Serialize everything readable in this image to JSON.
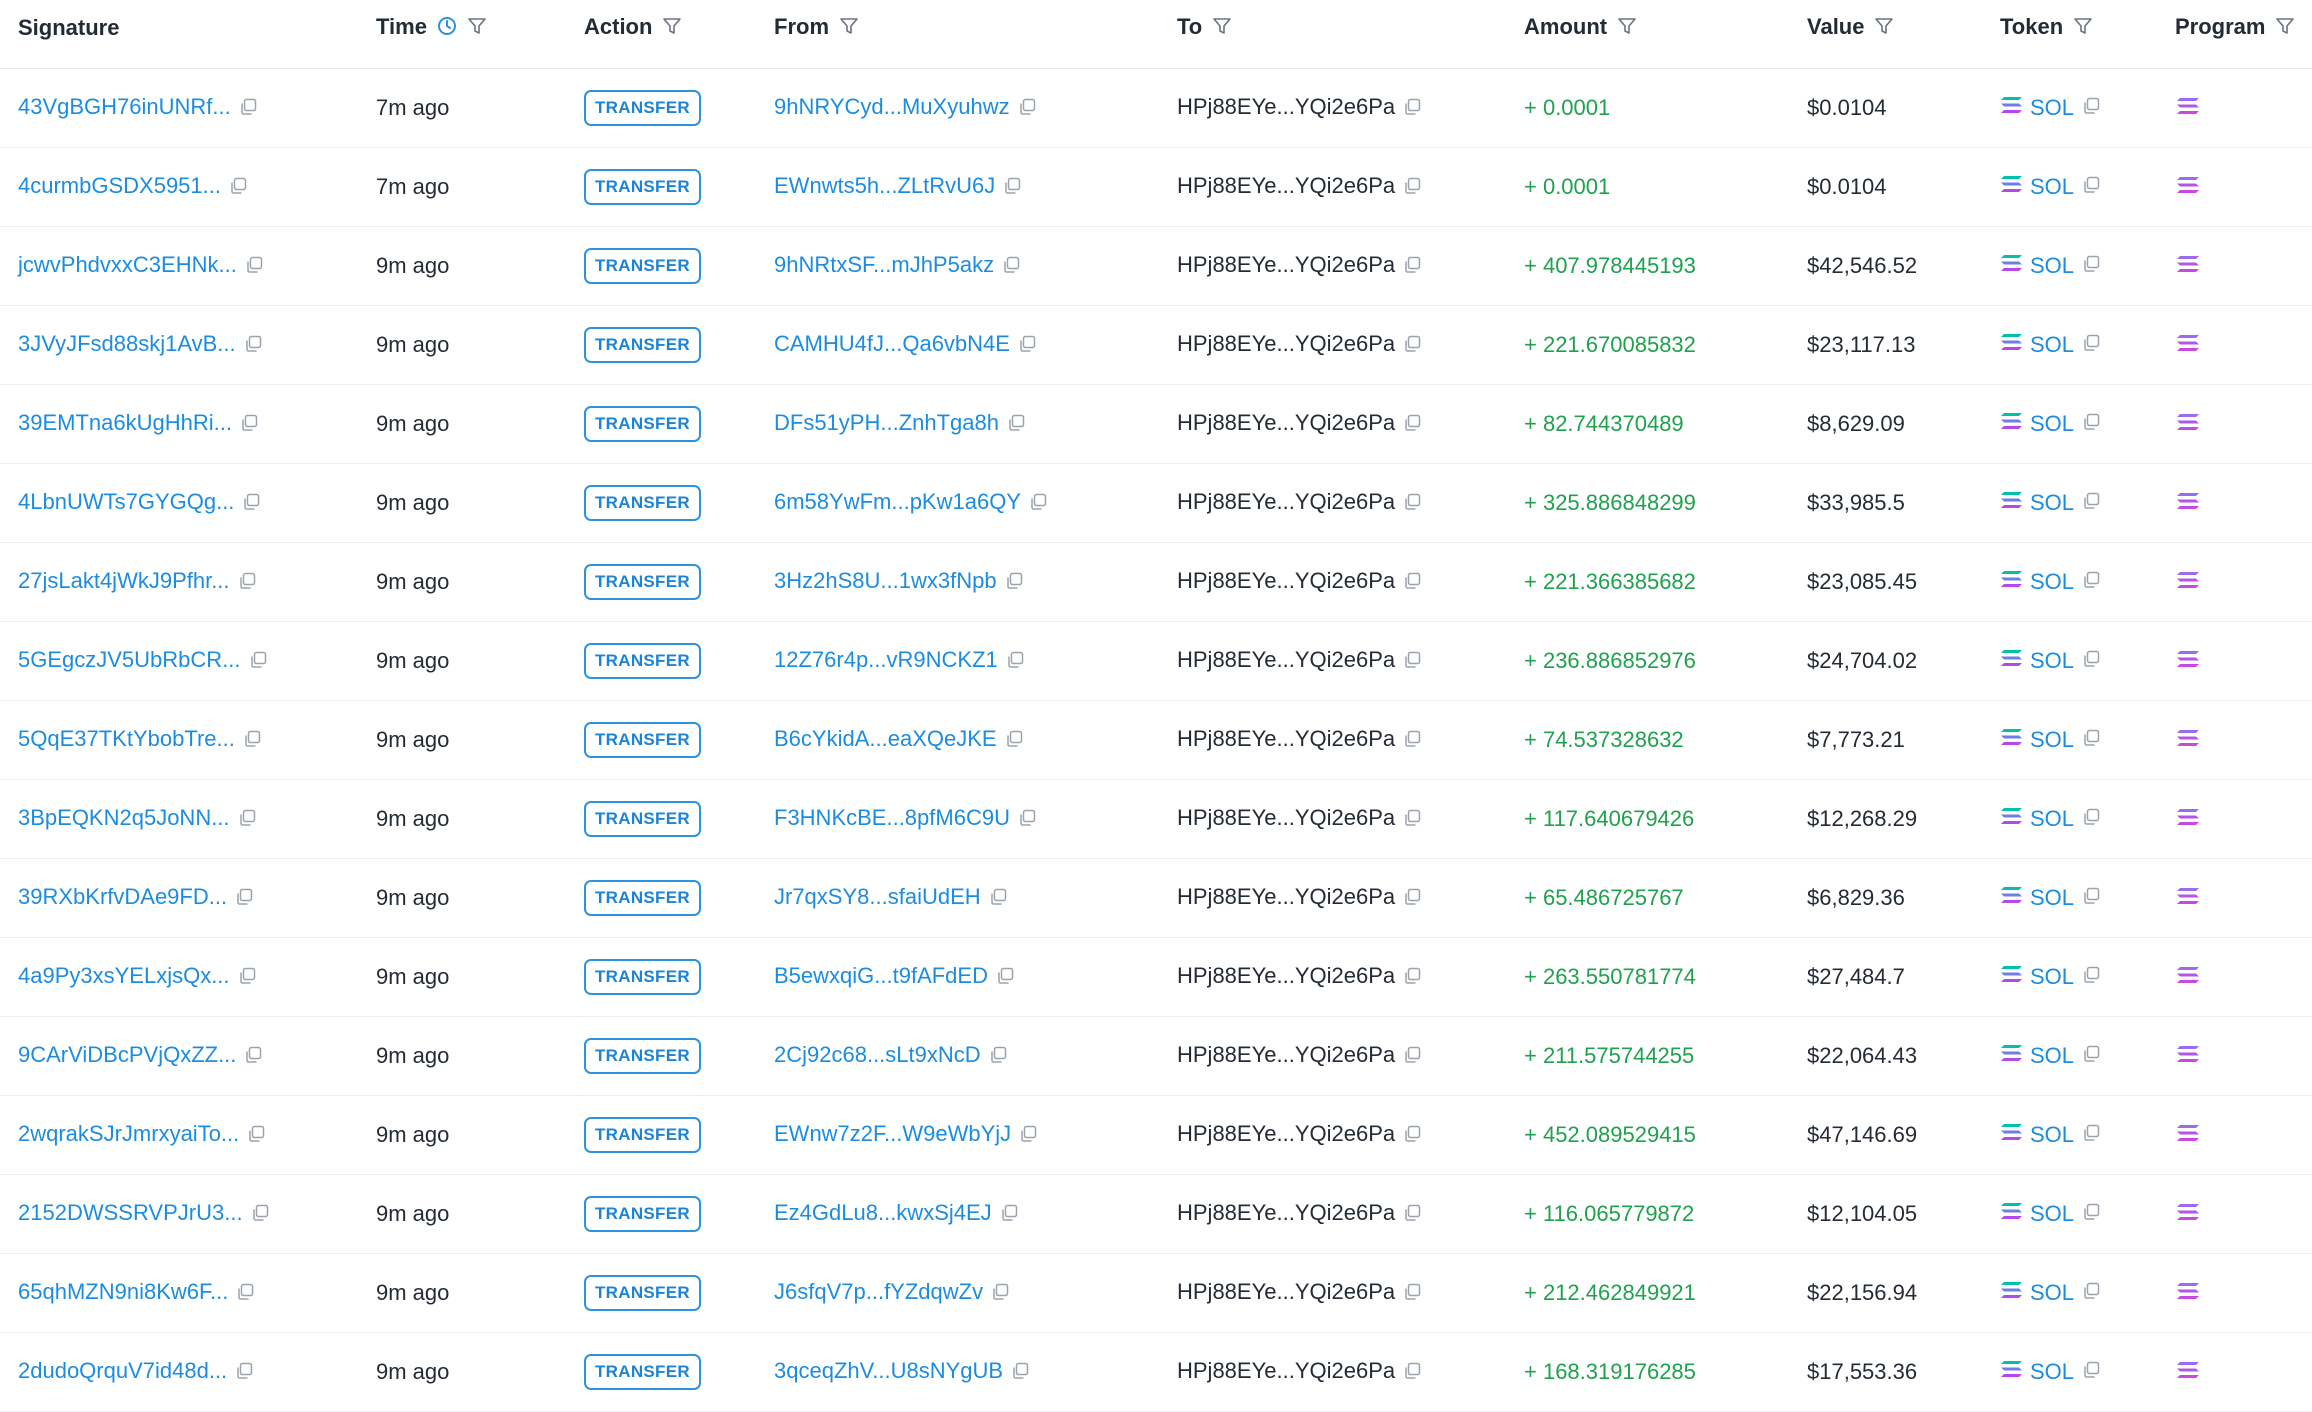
{
  "columns": {
    "signature": "Signature",
    "time": "Time",
    "action": "Action",
    "from": "From",
    "to": "To",
    "amount": "Amount",
    "value": "Value",
    "token": "Token",
    "program": "Program"
  },
  "icons": {
    "filter": "filter-icon",
    "clock": "clock-icon",
    "copy": "copy-icon",
    "token": "solana-logo-icon"
  },
  "colors": {
    "link": "#1c8ce0",
    "amount_positive": "#1fa14d",
    "badge": "#2b93e0"
  },
  "rows": [
    {
      "signature": "43VgBGH76inUNRf...",
      "time": "7m ago",
      "action": "TRANSFER",
      "from": "9hNRYCyd...MuXyuhwz",
      "to": "HPj88EYe...YQi2e6Pa",
      "amount": "+ 0.0001",
      "value": "$0.0104",
      "token": "SOL"
    },
    {
      "signature": "4curmbGSDX5951...",
      "time": "7m ago",
      "action": "TRANSFER",
      "from": "EWnwts5h...ZLtRvU6J",
      "to": "HPj88EYe...YQi2e6Pa",
      "amount": "+ 0.0001",
      "value": "$0.0104",
      "token": "SOL"
    },
    {
      "signature": "jcwvPhdvxxC3EHNk...",
      "time": "9m ago",
      "action": "TRANSFER",
      "from": "9hNRtxSF...mJhP5akz",
      "to": "HPj88EYe...YQi2e6Pa",
      "amount": "+ 407.978445193",
      "value": "$42,546.52",
      "token": "SOL"
    },
    {
      "signature": "3JVyJFsd88skj1AvB...",
      "time": "9m ago",
      "action": "TRANSFER",
      "from": "CAMHU4fJ...Qa6vbN4E",
      "to": "HPj88EYe...YQi2e6Pa",
      "amount": "+ 221.670085832",
      "value": "$23,117.13",
      "token": "SOL"
    },
    {
      "signature": "39EMTna6kUgHhRi...",
      "time": "9m ago",
      "action": "TRANSFER",
      "from": "DFs51yPH...ZnhTga8h",
      "to": "HPj88EYe...YQi2e6Pa",
      "amount": "+ 82.744370489",
      "value": "$8,629.09",
      "token": "SOL"
    },
    {
      "signature": "4LbnUWTs7GYGQg...",
      "time": "9m ago",
      "action": "TRANSFER",
      "from": "6m58YwFm...pKw1a6QY",
      "to": "HPj88EYe...YQi2e6Pa",
      "amount": "+ 325.886848299",
      "value": "$33,985.5",
      "token": "SOL"
    },
    {
      "signature": "27jsLakt4jWkJ9Pfhr...",
      "time": "9m ago",
      "action": "TRANSFER",
      "from": "3Hz2hS8U...1wx3fNpb",
      "to": "HPj88EYe...YQi2e6Pa",
      "amount": "+ 221.366385682",
      "value": "$23,085.45",
      "token": "SOL"
    },
    {
      "signature": "5GEgczJV5UbRbCR...",
      "time": "9m ago",
      "action": "TRANSFER",
      "from": "12Z76r4p...vR9NCKZ1",
      "to": "HPj88EYe...YQi2e6Pa",
      "amount": "+ 236.886852976",
      "value": "$24,704.02",
      "token": "SOL"
    },
    {
      "signature": "5QqE37TKtYbobTre...",
      "time": "9m ago",
      "action": "TRANSFER",
      "from": "B6cYkidA...eaXQeJKE",
      "to": "HPj88EYe...YQi2e6Pa",
      "amount": "+ 74.537328632",
      "value": "$7,773.21",
      "token": "SOL"
    },
    {
      "signature": "3BpEQKN2q5JoNN...",
      "time": "9m ago",
      "action": "TRANSFER",
      "from": "F3HNKcBE...8pfM6C9U",
      "to": "HPj88EYe...YQi2e6Pa",
      "amount": "+ 117.640679426",
      "value": "$12,268.29",
      "token": "SOL"
    },
    {
      "signature": "39RXbKrfvDAe9FD...",
      "time": "9m ago",
      "action": "TRANSFER",
      "from": "Jr7qxSY8...sfaiUdEH",
      "to": "HPj88EYe...YQi2e6Pa",
      "amount": "+ 65.486725767",
      "value": "$6,829.36",
      "token": "SOL"
    },
    {
      "signature": "4a9Py3xsYELxjsQx...",
      "time": "9m ago",
      "action": "TRANSFER",
      "from": "B5ewxqiG...t9fAFdED",
      "to": "HPj88EYe...YQi2e6Pa",
      "amount": "+ 263.550781774",
      "value": "$27,484.7",
      "token": "SOL"
    },
    {
      "signature": "9CArViDBcPVjQxZZ...",
      "time": "9m ago",
      "action": "TRANSFER",
      "from": "2Cj92c68...sLt9xNcD",
      "to": "HPj88EYe...YQi2e6Pa",
      "amount": "+ 211.575744255",
      "value": "$22,064.43",
      "token": "SOL"
    },
    {
      "signature": "2wqrakSJrJmrxyaiTo...",
      "time": "9m ago",
      "action": "TRANSFER",
      "from": "EWnw7z2F...W9eWbYjJ",
      "to": "HPj88EYe...YQi2e6Pa",
      "amount": "+ 452.089529415",
      "value": "$47,146.69",
      "token": "SOL"
    },
    {
      "signature": "2152DWSSRVPJrU3...",
      "time": "9m ago",
      "action": "TRANSFER",
      "from": "Ez4GdLu8...kwxSj4EJ",
      "to": "HPj88EYe...YQi2e6Pa",
      "amount": "+ 116.065779872",
      "value": "$12,104.05",
      "token": "SOL"
    },
    {
      "signature": "65qhMZN9ni8Kw6F...",
      "time": "9m ago",
      "action": "TRANSFER",
      "from": "J6sfqV7p...fYZdqwZv",
      "to": "HPj88EYe...YQi2e6Pa",
      "amount": "+ 212.462849921",
      "value": "$22,156.94",
      "token": "SOL"
    },
    {
      "signature": "2dudoQrquV7id48d...",
      "time": "9m ago",
      "action": "TRANSFER",
      "from": "3qceqZhV...U8sNYgUB",
      "to": "HPj88EYe...YQi2e6Pa",
      "amount": "+ 168.319176285",
      "value": "$17,553.36",
      "token": "SOL"
    }
  ]
}
